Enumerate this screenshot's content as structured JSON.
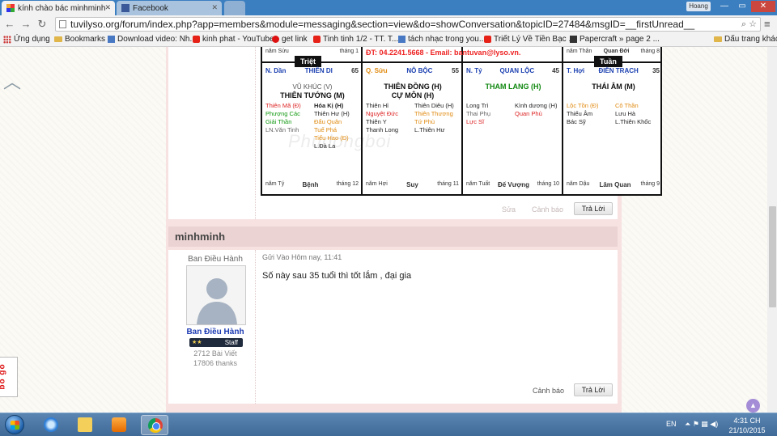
{
  "browser": {
    "tabs": [
      {
        "title": "kính chào bác minhminh ·",
        "active": true
      },
      {
        "title": "Facebook",
        "active": false
      }
    ],
    "profile_name": "Hoang",
    "url": "tuvilyso.org/forum/index.php?app=members&module=messaging&section=view&do=showConversation&topicID=27484&msgID=__firstUnread__",
    "bookmarks": [
      "Ứng dụng",
      "Bookmarks",
      "Download video: Nh...",
      "kinh phat - YouTube",
      "get link",
      "Tinh tinh 1/2 - TT. T...",
      "tách nhạc trong you...",
      "Triết Lý Về Tiền Bạc ...",
      "Papercraft » page 2 ..."
    ],
    "other_bookmarks": "Dấu trang khác"
  },
  "chart": {
    "contact": "ĐT: 04.2241.5668 - Email: bantuvan@lyso.vn.",
    "watermark": "Phudongboi",
    "cells": [
      {
        "top_left": "năm Sửu",
        "top_right": "tháng 1",
        "tag": "Triệt",
        "branch": "N. Dần",
        "palace": "THIÊN DI",
        "age": "65",
        "main_stars": [
          "VŨ KHÚC (V)",
          "THIÊN TƯỚNG (M)"
        ],
        "left_stars": [
          "Thiên Mã (Đ)",
          "Phượng Các",
          "Giải Thần",
          "LN.Văn Tinh"
        ],
        "right_stars": [
          "Hóa Kị (H)",
          "Thiên Hư (H)",
          "Đẩu Quân",
          "Tuế Phá",
          "Tiểu Hao (Đ)",
          "L.Đà La"
        ],
        "bot_left": "năm Tý",
        "bot_mid": "Bệnh",
        "bot_right": "tháng 12"
      },
      {
        "top_left": "",
        "top_right": "",
        "branch": "Q. Sửu",
        "palace": "NÔ BỘC",
        "age": "55",
        "main_stars": [
          "THIÊN ĐỒNG (H)",
          "CỰ MÔN (H)"
        ],
        "left_stars": [
          "Thiên Hỉ",
          "Nguyệt Đức",
          "Thiên Y",
          "Thanh Long"
        ],
        "right_stars": [
          "Thiên Diêu (H)",
          "Thiên Thương",
          "Tứ Phù",
          "L.Thiên Hư"
        ],
        "bot_left": "năm Hợi",
        "bot_mid": "Suy",
        "bot_right": "tháng 11"
      },
      {
        "top_left": "",
        "top_right": "",
        "branch": "N. Tý",
        "palace": "QUAN LỘC",
        "age": "45",
        "main_stars": [
          "THAM LANG (H)"
        ],
        "left_stars": [
          "Long Trì",
          "Thai Phụ",
          "Lực Sĩ"
        ],
        "right_stars": [
          "Kình dương (H)",
          "Quan Phù"
        ],
        "bot_left": "năm Tuất",
        "bot_mid": "Đế Vượng",
        "bot_right": "tháng 10"
      },
      {
        "top_left": "năm Thân",
        "top_mid": "Quan Đới",
        "top_right": "tháng 8",
        "tag": "Tuần",
        "branch": "T. Hợi",
        "palace": "ĐIỀN TRẠCH",
        "age": "35",
        "main_stars": [
          "THÁI ÂM (M)"
        ],
        "left_stars": [
          "Lộc Tồn (Đ)",
          "Thiếu Âm",
          "Bác Sỹ"
        ],
        "right_stars": [
          "Cô Thần",
          "Lưu Hà",
          "L.Thiên Khốc"
        ],
        "bot_left": "năm Dậu",
        "bot_mid": "Lâm Quan",
        "bot_right": "tháng 9"
      }
    ]
  },
  "post1": {
    "edit_label": "Sửa",
    "report_label": "Cảnh báo",
    "reply_label": "Trả Lời"
  },
  "post2": {
    "author": "minhminh",
    "rank": "Ban Điều Hành",
    "user_name": "Ban Điều Hành",
    "badge_stars": "★★",
    "badge": "Staff",
    "post_count": "2712 Bài Viết",
    "thanks": "17806 thanks",
    "sent": "Gửi Vào Hôm nay, 11:41",
    "message": "Số này sau 35 tuổi thì tốt lắm , đại gia",
    "report_label": "Cảnh báo",
    "reply_label": "Trả Lời"
  },
  "widget": {
    "label": "bo go"
  },
  "taskbar": {
    "lang": "EN",
    "time": "4:31 CH",
    "date": "21/10/2015"
  }
}
